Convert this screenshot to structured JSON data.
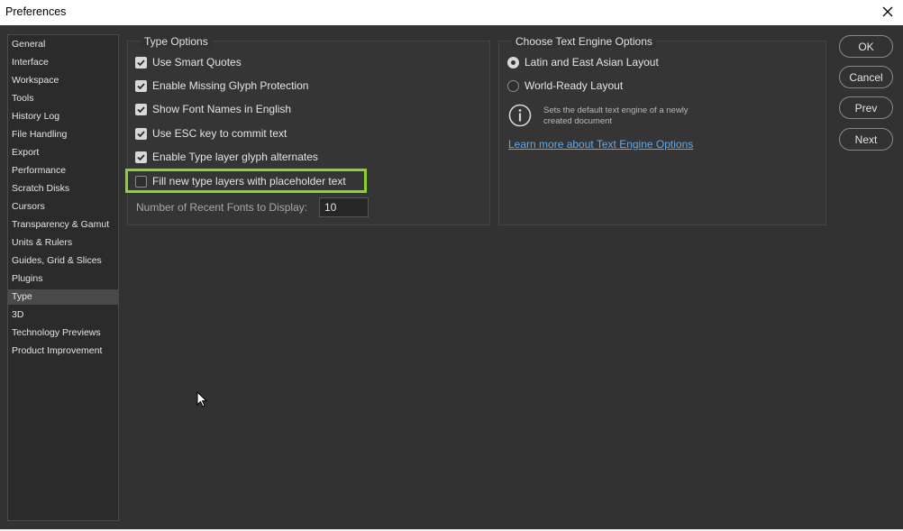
{
  "window": {
    "title": "Preferences"
  },
  "sidebar": {
    "items": [
      {
        "label": "General",
        "selected": false
      },
      {
        "label": "Interface",
        "selected": false
      },
      {
        "label": "Workspace",
        "selected": false
      },
      {
        "label": "Tools",
        "selected": false
      },
      {
        "label": "History Log",
        "selected": false
      },
      {
        "label": "File Handling",
        "selected": false
      },
      {
        "label": "Export",
        "selected": false
      },
      {
        "label": "Performance",
        "selected": false
      },
      {
        "label": "Scratch Disks",
        "selected": false
      },
      {
        "label": "Cursors",
        "selected": false
      },
      {
        "label": "Transparency & Gamut",
        "selected": false
      },
      {
        "label": "Units & Rulers",
        "selected": false
      },
      {
        "label": "Guides, Grid & Slices",
        "selected": false
      },
      {
        "label": "Plugins",
        "selected": false
      },
      {
        "label": "Type",
        "selected": true
      },
      {
        "label": "3D",
        "selected": false
      },
      {
        "label": "Technology Previews",
        "selected": false
      },
      {
        "label": "Product Improvement",
        "selected": false
      }
    ]
  },
  "type_options": {
    "legend": "Type Options",
    "checkboxes": [
      {
        "label": "Use Smart Quotes",
        "checked": true
      },
      {
        "label": "Enable Missing Glyph Protection",
        "checked": true
      },
      {
        "label": "Show Font Names in English",
        "checked": true
      },
      {
        "label": "Use ESC key to commit text",
        "checked": true
      },
      {
        "label": "Enable Type layer glyph alternates",
        "checked": true
      },
      {
        "label": "Fill new type layers with placeholder text",
        "checked": false
      }
    ],
    "recent_fonts_label": "Number of Recent Fonts to Display:",
    "recent_fonts_value": "10"
  },
  "text_engine": {
    "legend": "Choose Text Engine Options",
    "radios": [
      {
        "label": "Latin and East Asian Layout",
        "selected": true
      },
      {
        "label": "World-Ready Layout",
        "selected": false
      }
    ],
    "info_text": "Sets the default text engine of a newly created document",
    "learn_more": "Learn more about Text Engine Options"
  },
  "buttons": {
    "ok": "OK",
    "cancel": "Cancel",
    "prev": "Prev",
    "next": "Next"
  },
  "colors": {
    "dialog_bg": "#323232",
    "highlight": "#8dd12b",
    "link": "#63a8ea"
  },
  "icons": {
    "close": "close-icon",
    "info": "info-icon",
    "check": "checkmark-icon",
    "cursor": "mouse-pointer-icon"
  }
}
